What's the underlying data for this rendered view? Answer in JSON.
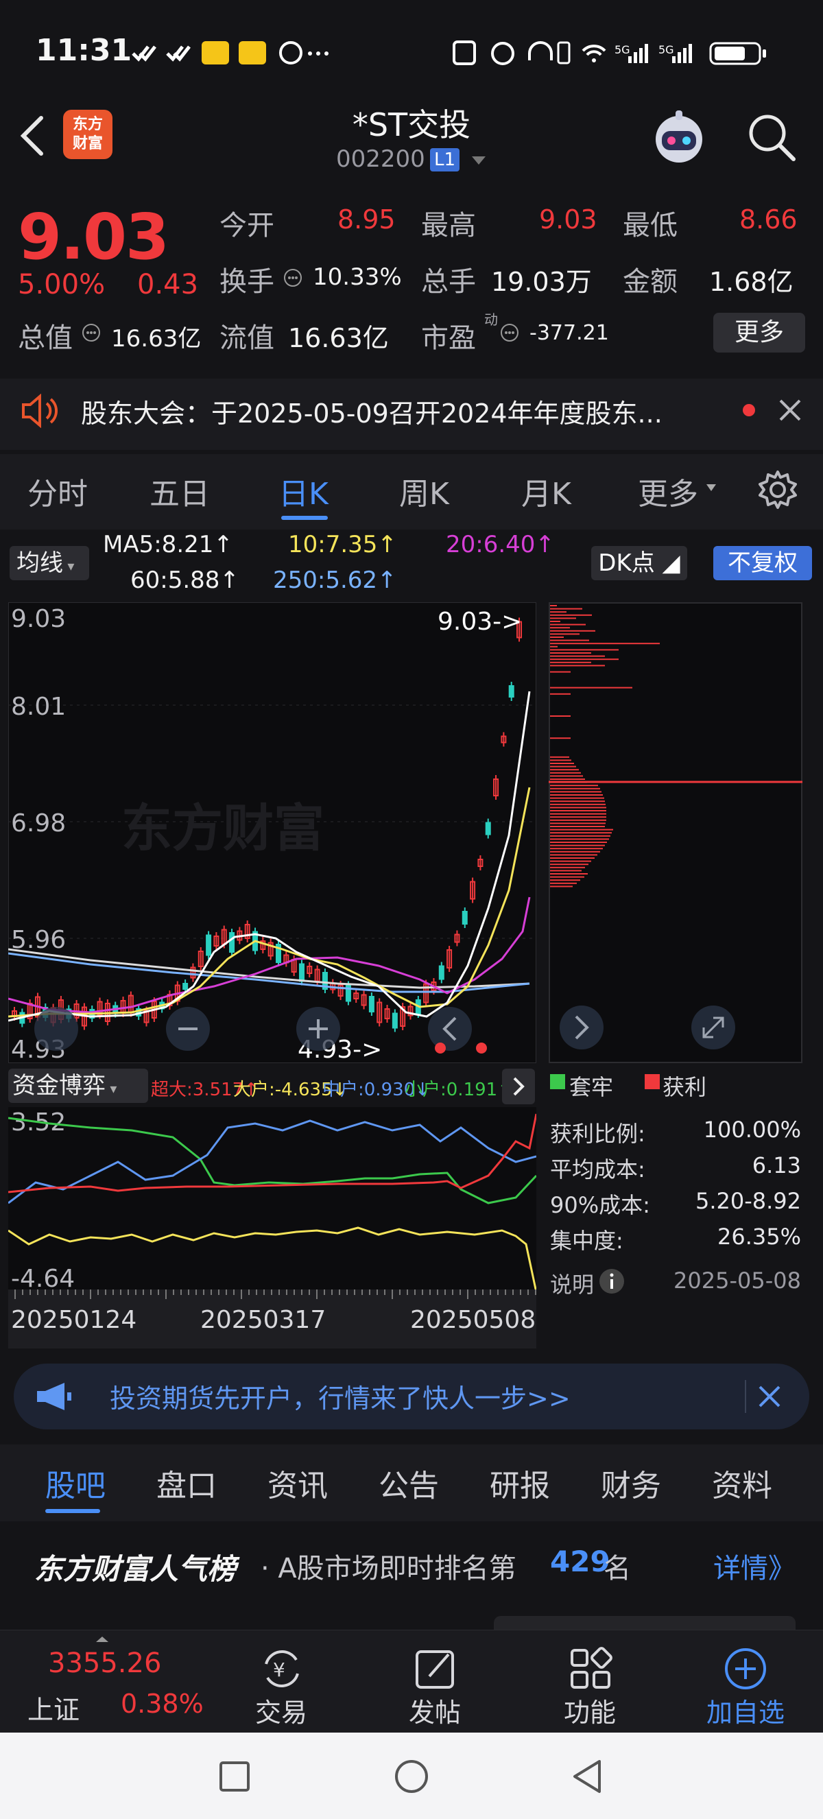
{
  "status_bar": {
    "time": "11:31",
    "net1": "5G",
    "net2": "5G"
  },
  "header": {
    "title": "*ST交投",
    "code": "002200",
    "badge": "L1",
    "logo_line1": "东方",
    "logo_line2": "财富"
  },
  "quote": {
    "price": "9.03",
    "change_pct": "5.00%",
    "change_val": "0.43",
    "open_label": "今开",
    "open": "8.95",
    "high_label": "最高",
    "high": "9.03",
    "low_label": "最低",
    "low": "8.66",
    "turnover_label": "换手",
    "turnover": "10.33%",
    "volume_label": "总手",
    "volume": "19.03万",
    "amount_label": "金额",
    "amount": "1.68亿",
    "mcap_label": "总值",
    "mcap": "16.63亿",
    "float_label": "流值",
    "float": "16.63亿",
    "pe_label": "市盈",
    "pe_sup": "动",
    "pe": "-377.21",
    "more": "更多"
  },
  "notice": {
    "text": "股东大会：于2025-05-09召开2024年年度股东..."
  },
  "period_tabs": [
    {
      "label": "分时"
    },
    {
      "label": "五日"
    },
    {
      "label": "日K"
    },
    {
      "label": "周K"
    },
    {
      "label": "月K"
    },
    {
      "label": "更多"
    }
  ],
  "ma_bar": {
    "selector": "均线",
    "ma5": "MA5:8.21↑",
    "ma10": "10:7.35↑",
    "ma20": "20:6.40↑",
    "ma60": "60:5.88↑",
    "ma250": "250:5.62↑",
    "dk": "DK点",
    "adjust": "不复权"
  },
  "kchart": {
    "y_labels": [
      "9.03",
      "8.01",
      "6.98",
      "5.96",
      "4.93"
    ],
    "high_marker": "9.03->",
    "low_marker": "4.93->",
    "watermark": "东方财富"
  },
  "colors": {
    "up": "#f0393c",
    "down": "#2ad0c0",
    "ma5": "#ffffff",
    "ma10": "#f5e45a",
    "ma20": "#d73fd6",
    "ma60": "#7ab3ff",
    "ma250": "#e6e6e6",
    "accent": "#4a8ff7"
  },
  "fund": {
    "selector": "资金博弈",
    "super": "超大:3.517↑",
    "big": "大户:-4.635↓",
    "mid": "中户:0.930↓",
    "small": "小户:0.191↑",
    "y_top": "3.52",
    "y_bottom": "-4.64",
    "dates": [
      "20250124",
      "20250317",
      "20250508"
    ]
  },
  "chip": {
    "legend_trap": "套牢",
    "legend_profit": "获利",
    "profit_ratio_label": "获利比例:",
    "profit_ratio": "100.00%",
    "avg_cost_label": "平均成本:",
    "avg_cost": "6.13",
    "cost90_label": "90%成本:",
    "cost90": "5.20-8.92",
    "concentration_label": "集中度:",
    "concentration": "26.35%",
    "explain": "说明",
    "date": "2025-05-08"
  },
  "ad": {
    "text": "投资期货先开户，行情来了快人一步>>"
  },
  "content_tabs": [
    {
      "label": "股吧"
    },
    {
      "label": "盘口"
    },
    {
      "label": "资讯"
    },
    {
      "label": "公告"
    },
    {
      "label": "研报"
    },
    {
      "label": "财务"
    },
    {
      "label": "资料"
    }
  ],
  "rank": {
    "title": "东方财富人气榜",
    "text": "· A股市场即时排名第",
    "num": "429",
    "suffix": "名",
    "detail": "详情》"
  },
  "bottom_bar": {
    "index_value": "3355.26",
    "index_name": "上证",
    "index_pct": "0.38%",
    "items": [
      {
        "label": "交易"
      },
      {
        "label": "发帖"
      },
      {
        "label": "功能"
      },
      {
        "label": "加自选"
      }
    ]
  }
}
